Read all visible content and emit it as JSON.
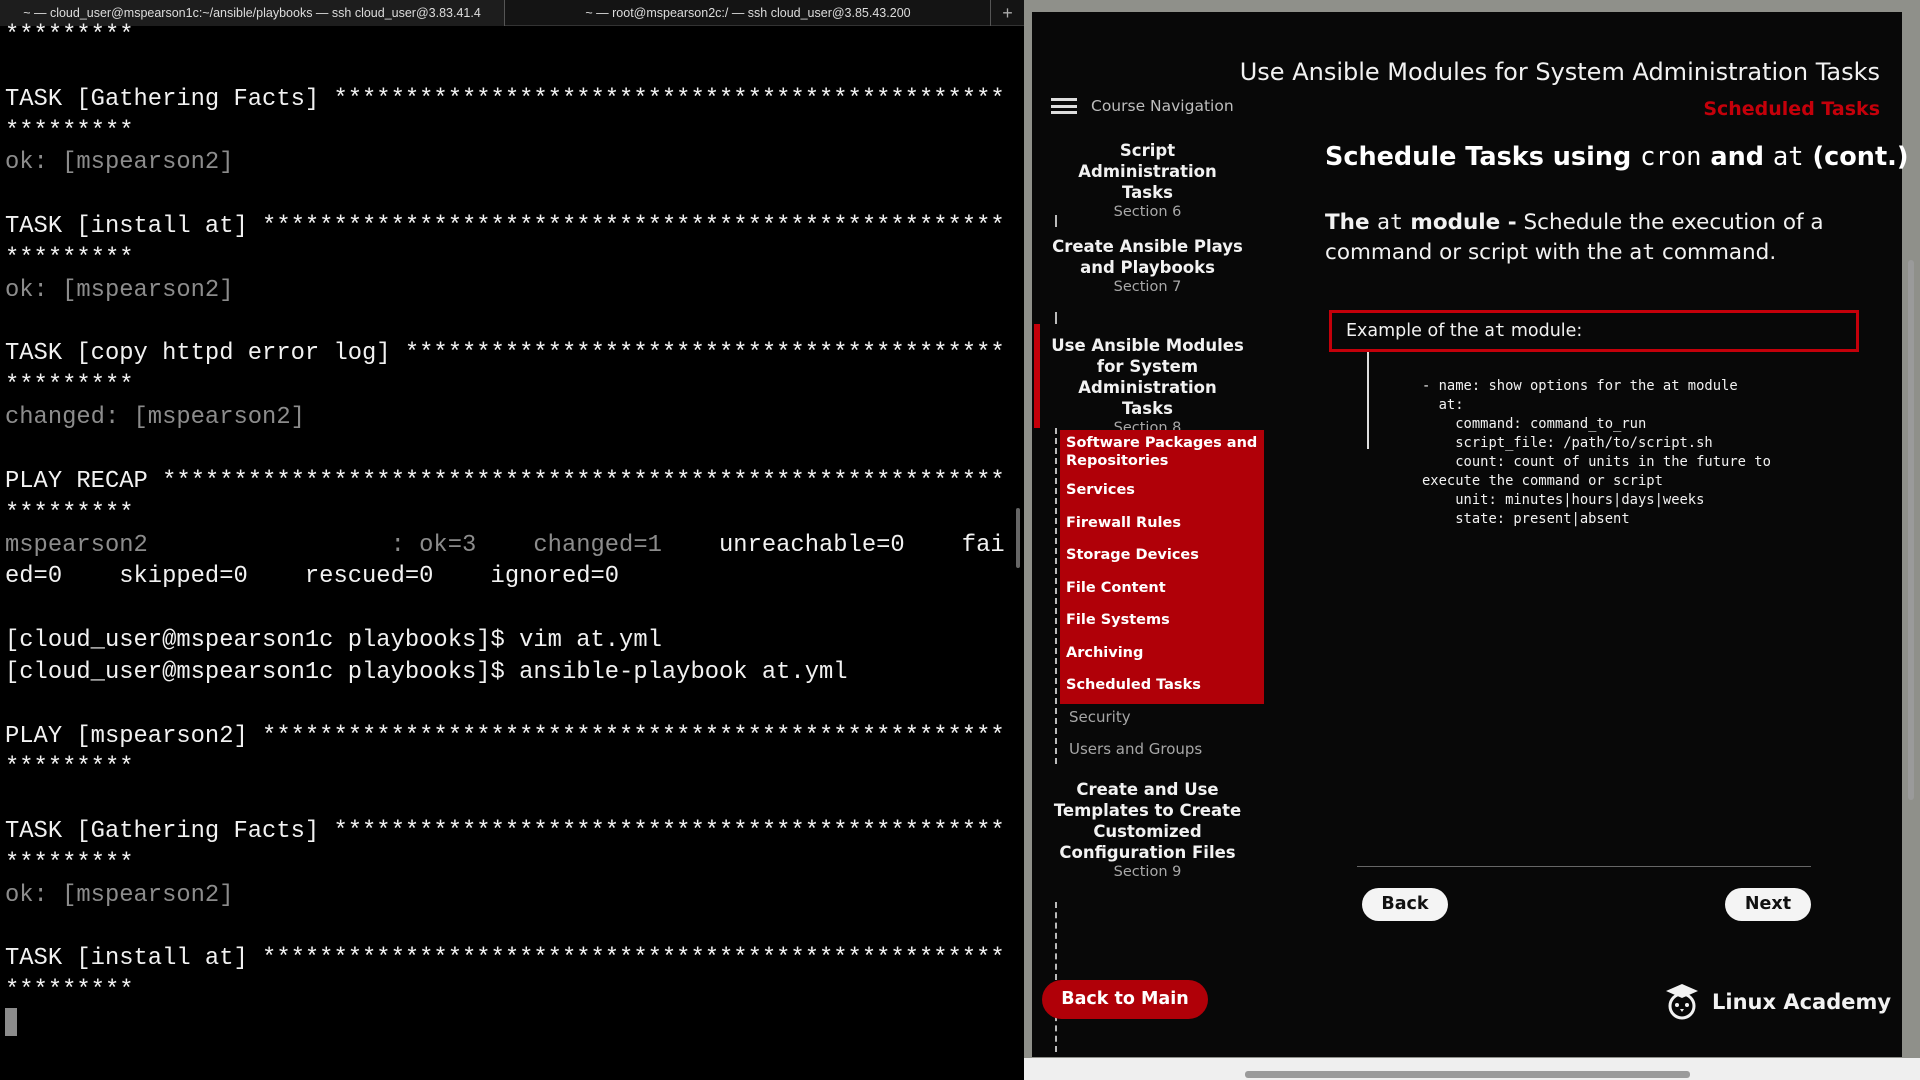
{
  "terminal": {
    "tabs": [
      "~ — cloud_user@mspearson1c:~/ansible/playbooks — ssh cloud_user@3.83.41.4",
      "~ — root@mspearson2c:/ — ssh cloud_user@3.85.43.200"
    ],
    "new_tab": "+",
    "lines": [
      [
        [
          "*********",
          ""
        ]
      ],
      [],
      [
        [
          "TASK [Gathering Facts] ***********************************************",
          ""
        ]
      ],
      [
        [
          "*********",
          ""
        ]
      ],
      [
        [
          "ok: [mspearson2]",
          "g"
        ]
      ],
      [],
      [
        [
          "TASK [install at] ****************************************************",
          ""
        ]
      ],
      [
        [
          "*********",
          ""
        ]
      ],
      [
        [
          "ok: [mspearson2]",
          "g"
        ]
      ],
      [],
      [
        [
          "TASK [copy httpd error log] *******************************************",
          ""
        ]
      ],
      [
        [
          "*********",
          ""
        ]
      ],
      [
        [
          "changed: [mspearson2]",
          "g"
        ]
      ],
      [],
      [
        [
          "PLAY RECAP ***********************************************************",
          ""
        ]
      ],
      [
        [
          "*********",
          ""
        ]
      ],
      [
        [
          "mspearson2                 : ok=3    changed=1    ",
          "g"
        ],
        [
          "unreachable=0    fail",
          ""
        ]
      ],
      [
        [
          "ed=0    skipped=0    rescued=0    ignored=0",
          ""
        ]
      ],
      [],
      [
        [
          "[cloud_user@mspearson1c playbooks]$ vim at.yml",
          ""
        ]
      ],
      [
        [
          "[cloud_user@mspearson1c playbooks]$ ansible-playbook at.yml",
          ""
        ]
      ],
      [],
      [
        [
          "PLAY [mspearson2] ****************************************************",
          ""
        ]
      ],
      [
        [
          "*********",
          ""
        ]
      ],
      [],
      [
        [
          "TASK [Gathering Facts] ***********************************************",
          ""
        ]
      ],
      [
        [
          "*********",
          ""
        ]
      ],
      [
        [
          "ok: [mspearson2]",
          "g"
        ]
      ],
      [],
      [
        [
          "TASK [install at] ****************************************************",
          ""
        ]
      ],
      [
        [
          "*********",
          ""
        ]
      ]
    ]
  },
  "course": {
    "title": "Use Ansible Modules for System Administration Tasks",
    "subtitle": "Scheduled Tasks",
    "nav_label": "Course Navigation",
    "sections": [
      {
        "title": "Script Administration Tasks",
        "section": "Section 6"
      },
      {
        "title": "Create Ansible Plays and Playbooks",
        "section": "Section 7"
      },
      {
        "title": "Use Ansible Modules for System Administration Tasks",
        "section": "Section 8"
      },
      {
        "title": "Create and Use Templates to Create Customized Configuration Files",
        "section": "Section 9"
      }
    ],
    "completed_items": [
      "Software Packages and Repositories",
      "Services",
      "Firewall Rules",
      "Storage Devices",
      "File Content",
      "File Systems",
      "Archiving",
      "Scheduled Tasks"
    ],
    "pending_items": [
      "Security",
      "Users and Groups"
    ],
    "back_to_main": "Back to Main",
    "heading": {
      "pre": "Schedule Tasks using ",
      "code1": "cron",
      "mid": " and ",
      "code2": "at",
      "post": " (cont.)"
    },
    "para": {
      "b1": "The ",
      "code": "at",
      "b2": " module -",
      "t1": " Schedule the execution of a command or script with the ",
      "code2": "at",
      "t2": " command."
    },
    "example_label": {
      "pre": "Example of the ",
      "code": "at",
      "post": " module:"
    },
    "code": "- name: show options for the at module\n  at:\n    command: command_to_run\n    script_file: /path/to/script.sh\n    count: count of units in the future to\nexecute the command or script\n    unit: minutes|hours|days|weeks\n    state: present|absent",
    "back": "Back",
    "next": "Next",
    "logo": "Linux Academy",
    "accent": "#b00008"
  }
}
